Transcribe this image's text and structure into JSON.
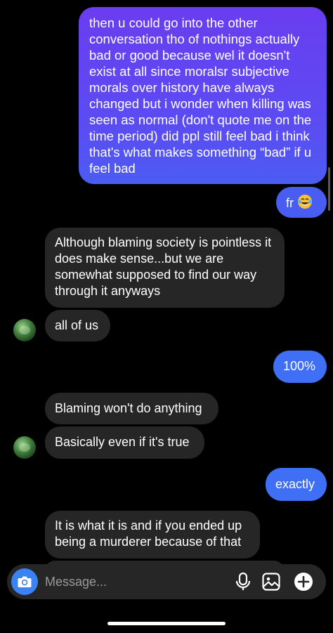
{
  "colors": {
    "sent_gradient_top": "#6a3df0",
    "sent_gradient_bottom": "#4a60f0",
    "sent_blue": "#3e6ff5",
    "received": "#262626",
    "camera_blue": "#3b82f6",
    "background": "#000000"
  },
  "messages": [
    {
      "id": "m1",
      "direction": "sent",
      "text": "then u could go into the other conversation tho of nothings actually bad or good because wel it doesn't exist at all since moralsr subjective morals over history have always changed but i wonder when killing was seen as normal (don't quote me on the time period) did ppl still feel bad i think that's what makes something “bad” if u feel bad"
    },
    {
      "id": "m2",
      "direction": "sent",
      "text": "fr",
      "emoji": "face-with-tears-of-joy"
    },
    {
      "id": "m3",
      "direction": "received",
      "text": "Although blaming society is pointless it does make sense...but we are somewhat supposed to find our way through it anyways"
    },
    {
      "id": "m4",
      "direction": "received",
      "text": "all of us"
    },
    {
      "id": "m5",
      "direction": "sent",
      "text": "100%"
    },
    {
      "id": "m6",
      "direction": "received",
      "text": "Blaming won't do anything"
    },
    {
      "id": "m7",
      "direction": "received",
      "text": "Basically even if it's true"
    },
    {
      "id": "m8",
      "direction": "sent",
      "text": "exactly"
    },
    {
      "id": "m9",
      "direction": "received",
      "text": "It is what it is and if you ended up being a murderer because of that"
    }
  ],
  "composer": {
    "placeholder": "Message...",
    "left_icon": "camera-icon",
    "right_icons": [
      "microphone-icon",
      "gallery-icon",
      "plus-icon"
    ]
  }
}
